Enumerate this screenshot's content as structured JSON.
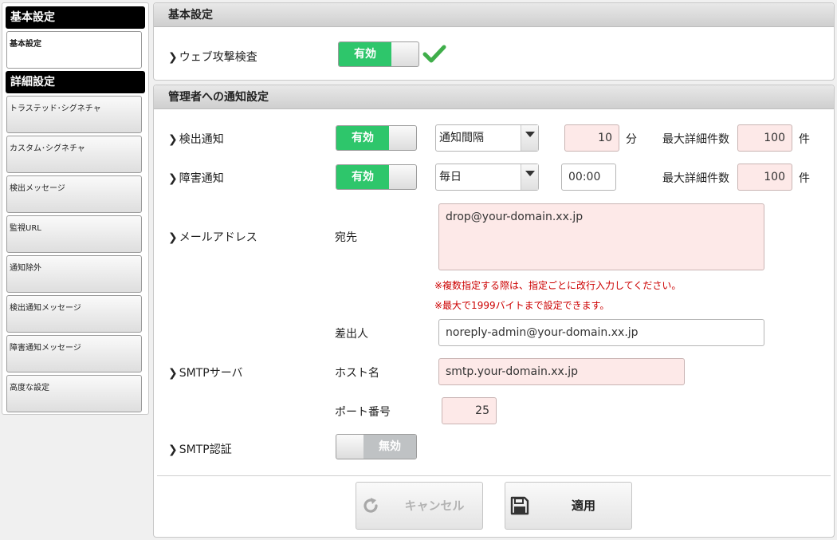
{
  "sidebar": {
    "basic_header": "基本設定",
    "basic_items": [
      {
        "label": "基本設定"
      }
    ],
    "detail_header": "詳細設定",
    "detail_items": [
      {
        "label": "トラステッド･シグネチャ"
      },
      {
        "label": "カスタム･シグネチャ"
      },
      {
        "label": "検出メッセージ"
      },
      {
        "label": "監視URL"
      },
      {
        "label": "通知除外"
      },
      {
        "label": "検出通知メッセージ"
      },
      {
        "label": "障害通知メッセージ"
      },
      {
        "label": "高度な設定"
      }
    ]
  },
  "basic_panel": {
    "title": "基本設定",
    "web_attack": {
      "label": "ウェブ攻撃検査",
      "toggle": "有効",
      "status_icon": "check-icon"
    }
  },
  "notify_panel": {
    "title": "管理者への通知設定",
    "detection": {
      "label": "検出通知",
      "toggle": "有効",
      "interval_select": "通知間隔",
      "interval_value": "10",
      "interval_unit": "分",
      "max_label": "最大詳細件数",
      "max_value": "100",
      "max_unit": "件"
    },
    "failure": {
      "label": "障害通知",
      "toggle": "有効",
      "schedule_select": "毎日",
      "time_value": "00:00",
      "max_label": "最大詳細件数",
      "max_value": "100",
      "max_unit": "件"
    },
    "mail": {
      "label": "メールアドレス",
      "to_label": "宛先",
      "to_value": "drop@your-domain.xx.jp",
      "note1": "※複数指定する際は、指定ごとに改行入力してください。",
      "note2": "※最大で1999バイトまで設定できます。",
      "from_label": "差出人",
      "from_value": "noreply-admin@your-domain.xx.jp"
    },
    "smtp": {
      "label": "SMTPサーバ",
      "host_label": "ホスト名",
      "host_value": "smtp.your-domain.xx.jp",
      "port_label": "ポート番号",
      "port_value": "25"
    },
    "smtp_auth": {
      "label": "SMTP認証",
      "toggle": "無効"
    }
  },
  "actions": {
    "cancel": {
      "label": "キャンセル",
      "icon": "refresh-icon",
      "disabled": true
    },
    "apply": {
      "label": "適用",
      "icon": "save-icon"
    }
  },
  "colors": {
    "toggle_on": "#2ec66b",
    "toggle_off": "#bfc2c4",
    "note": "#cc0000",
    "input_pink": "#fde9e8"
  }
}
